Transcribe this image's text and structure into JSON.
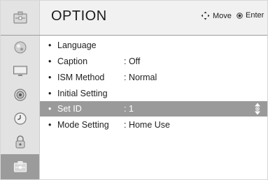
{
  "header": {
    "title": "OPTION",
    "hint_move": "Move",
    "hint_enter": "Enter"
  },
  "sidebar": {
    "items": [
      {
        "icon": "picture-category-icon",
        "selected": false
      },
      {
        "icon": "screen-category-icon",
        "selected": false
      },
      {
        "icon": "audio-category-icon",
        "selected": false
      },
      {
        "icon": "time-category-icon",
        "selected": false
      },
      {
        "icon": "lock-category-icon",
        "selected": false
      },
      {
        "icon": "option-category-icon",
        "selected": true
      }
    ]
  },
  "menu": {
    "bullet": "•",
    "items": [
      {
        "label": "Language",
        "value": ""
      },
      {
        "label": "Caption",
        "value": ": Off"
      },
      {
        "label": "ISM Method",
        "value": ": Normal"
      },
      {
        "label": "Initial Setting",
        "value": ""
      },
      {
        "label": "Set ID",
        "value": ": 1",
        "selected": true
      },
      {
        "label": "Mode Setting",
        "value": ": Home Use"
      }
    ]
  },
  "colors": {
    "header_bg": "#f1f1f1",
    "sidebar_bg": "#e2e2e2",
    "selected_bg": "#9a9a9a",
    "selected_text": "#ffffff",
    "text": "#1e1e1e"
  }
}
